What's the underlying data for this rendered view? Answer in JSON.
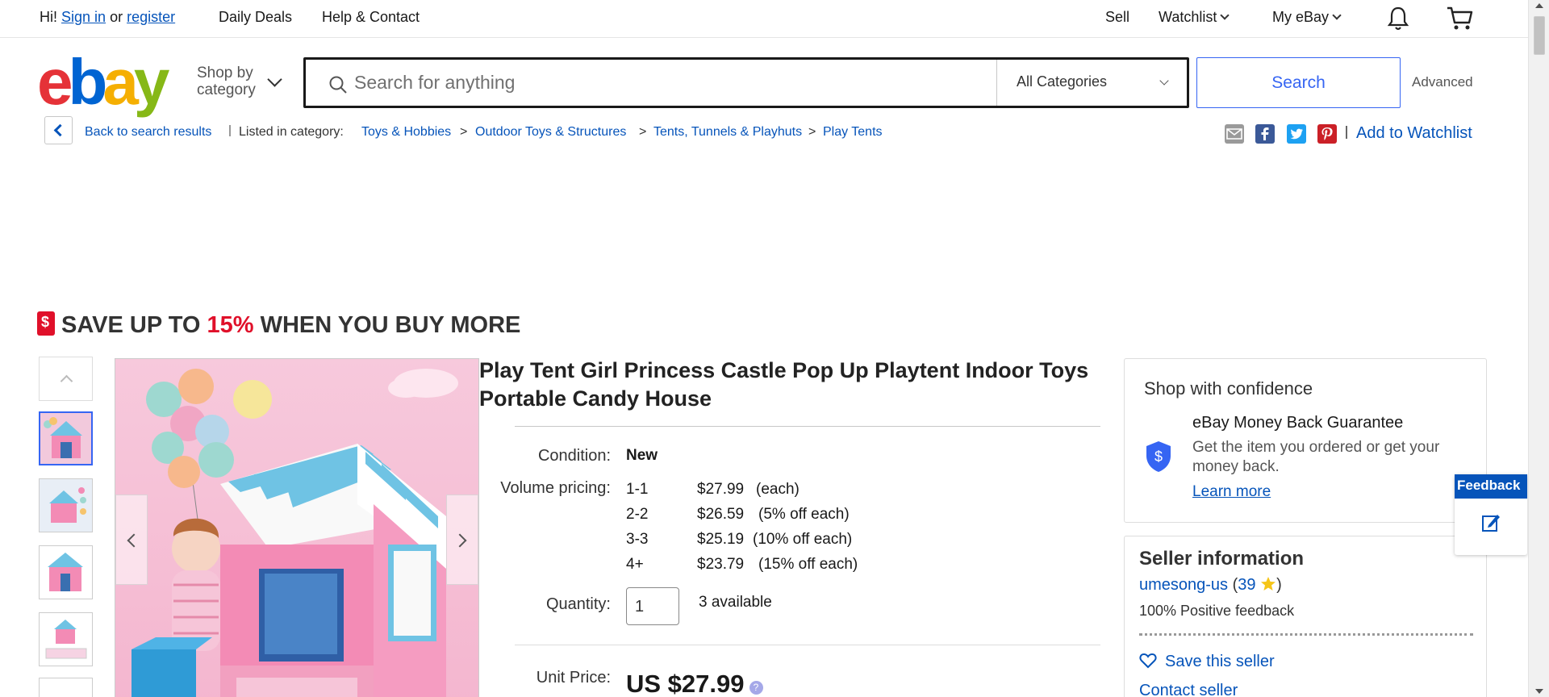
{
  "topbar": {
    "greeting": "Hi!",
    "sign_in": "Sign in",
    "or": "or",
    "register": "register",
    "daily_deals": "Daily Deals",
    "help_contact": "Help & Contact",
    "sell": "Sell",
    "watchlist": "Watchlist",
    "my_ebay": "My eBay",
    "bell_icon": "bell-icon",
    "cart_icon": "cart-icon"
  },
  "header": {
    "logo": [
      "e",
      "b",
      "a",
      "y"
    ],
    "logo_colors": [
      "#e53238",
      "#0064d2",
      "#f5af02",
      "#86b817"
    ],
    "shop_by": "Shop by",
    "category": "category",
    "search_placeholder": "Search for anything",
    "category_select": "All Categories",
    "search_button": "Search",
    "advanced": "Advanced"
  },
  "breadcrumb": {
    "back": "Back to search results",
    "listed_in": "Listed in category:",
    "items": [
      "Toys & Hobbies",
      "Outdoor Toys & Structures",
      "Tents, Tunnels & Playhuts",
      "Play Tents"
    ],
    "separator": ">",
    "add_to_watchlist": "Add to Watchlist",
    "share_icons": [
      "email-icon",
      "facebook-icon",
      "twitter-icon",
      "pinterest-icon"
    ]
  },
  "banner": {
    "prefix": "SAVE UP TO ",
    "percent": "15%",
    "suffix": " WHEN YOU BUY MORE"
  },
  "product": {
    "title": "Play Tent Girl Princess Castle Pop Up Playtent Indoor Toys Portable Candy House",
    "condition_label": "Condition:",
    "condition": "New",
    "volume_label": "Volume pricing:",
    "volume_pricing": [
      {
        "qty": "1-1",
        "price": "$27.99",
        "note": "(each)"
      },
      {
        "qty": "2-2",
        "price": "$26.59",
        "note": "(5% off each)"
      },
      {
        "qty": "3-3",
        "price": "$25.19",
        "note": "(10% off each)"
      },
      {
        "qty": "4+",
        "price": "$23.79",
        "note": "(15% off each)"
      }
    ],
    "quantity_label": "Quantity:",
    "quantity": "1",
    "available": "3 available",
    "unit_price_label": "Unit Price:",
    "unit_price": "US $27.99",
    "help_glyph": "?"
  },
  "confidence": {
    "heading": "Shop with confidence",
    "guarantee_title": "eBay Money Back Guarantee",
    "guarantee_text": "Get the item you ordered or get your money back.",
    "learn_more": "Learn more"
  },
  "seller": {
    "heading": "Seller information",
    "name": "umesong-us",
    "score_open": " (",
    "score": "39",
    "score_close": ")",
    "star_icon": "star-icon",
    "positive": "100% Positive feedback",
    "save_seller": "Save this seller",
    "contact": "Contact seller"
  },
  "feedback_tab": {
    "label": "Feedback"
  }
}
